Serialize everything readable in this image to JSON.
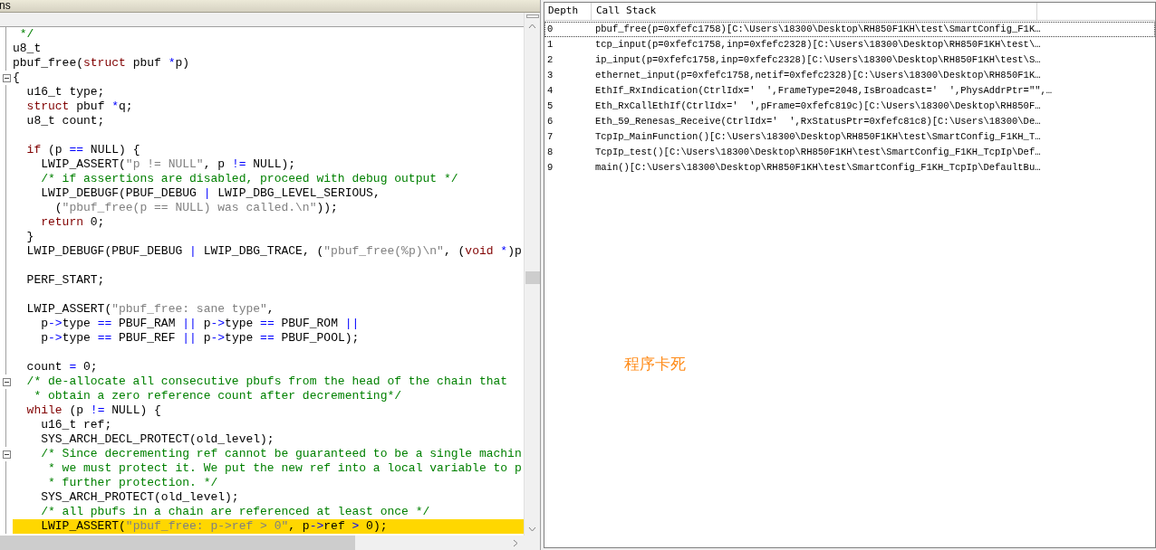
{
  "editor": {
    "title": "ns",
    "lines": [
      {
        "fold": false,
        "current": false,
        "tokens": [
          {
            "kind": "c",
            "text": " */"
          }
        ]
      },
      {
        "fold": false,
        "current": false,
        "tokens": [
          {
            "kind": "p",
            "text": "u8_t"
          }
        ]
      },
      {
        "fold": false,
        "current": false,
        "tokens": [
          {
            "kind": "p",
            "text": "pbuf_free("
          },
          {
            "kind": "k",
            "text": "struct"
          },
          {
            "kind": "p",
            "text": " pbuf "
          },
          {
            "kind": "o",
            "text": "*"
          },
          {
            "kind": "p",
            "text": "p)"
          }
        ]
      },
      {
        "fold": true,
        "current": false,
        "tokens": [
          {
            "kind": "p",
            "text": "{"
          }
        ]
      },
      {
        "fold": false,
        "current": false,
        "tokens": [
          {
            "kind": "p",
            "text": "  u16_t type;"
          }
        ]
      },
      {
        "fold": false,
        "current": false,
        "tokens": [
          {
            "kind": "k",
            "text": "  struct"
          },
          {
            "kind": "p",
            "text": " pbuf "
          },
          {
            "kind": "o",
            "text": "*"
          },
          {
            "kind": "p",
            "text": "q;"
          }
        ]
      },
      {
        "fold": false,
        "current": false,
        "tokens": [
          {
            "kind": "p",
            "text": "  u8_t count;"
          }
        ]
      },
      {
        "fold": false,
        "current": false
      },
      {
        "fold": false,
        "current": false,
        "tokens": [
          {
            "kind": "k",
            "text": "  if"
          },
          {
            "kind": "p",
            "text": " (p "
          },
          {
            "kind": "o",
            "text": "=="
          },
          {
            "kind": "p",
            "text": " NULL) {"
          }
        ]
      },
      {
        "fold": false,
        "current": false,
        "tokens": [
          {
            "kind": "p",
            "text": "    LWIP_ASSERT("
          },
          {
            "kind": "s",
            "text": "\"p != NULL\""
          },
          {
            "kind": "p",
            "text": ", p "
          },
          {
            "kind": "o",
            "text": "!="
          },
          {
            "kind": "p",
            "text": " NULL);"
          }
        ]
      },
      {
        "fold": false,
        "current": false,
        "tokens": [
          {
            "kind": "c",
            "text": "    /* if assertions are disabled, proceed with debug output */"
          }
        ]
      },
      {
        "fold": false,
        "current": false,
        "tokens": [
          {
            "kind": "p",
            "text": "    LWIP_DEBUGF(PBUF_DEBUG "
          },
          {
            "kind": "o",
            "text": "|"
          },
          {
            "kind": "p",
            "text": " LWIP_DBG_LEVEL_SERIOUS,"
          }
        ]
      },
      {
        "fold": false,
        "current": false,
        "tokens": [
          {
            "kind": "p",
            "text": "      ("
          },
          {
            "kind": "s",
            "text": "\"pbuf_free(p == NULL) was called.\\n\""
          },
          {
            "kind": "p",
            "text": "));"
          }
        ]
      },
      {
        "fold": false,
        "current": false,
        "tokens": [
          {
            "kind": "k",
            "text": "    return"
          },
          {
            "kind": "p",
            "text": " 0;"
          }
        ]
      },
      {
        "fold": false,
        "current": false,
        "tokens": [
          {
            "kind": "p",
            "text": "  }"
          }
        ]
      },
      {
        "fold": false,
        "current": false,
        "tokens": [
          {
            "kind": "p",
            "text": "  LWIP_DEBUGF(PBUF_DEBUG "
          },
          {
            "kind": "o",
            "text": "|"
          },
          {
            "kind": "p",
            "text": " LWIP_DBG_TRACE, ("
          },
          {
            "kind": "s",
            "text": "\"pbuf_free(%p)\\n\""
          },
          {
            "kind": "p",
            "text": ", ("
          },
          {
            "kind": "k",
            "text": "void"
          },
          {
            "kind": "o",
            "text": " *"
          },
          {
            "kind": "p",
            "text": ")p"
          }
        ]
      },
      {
        "fold": false,
        "current": false
      },
      {
        "fold": false,
        "current": false,
        "tokens": [
          {
            "kind": "p",
            "text": "  PERF_START;"
          }
        ]
      },
      {
        "fold": false,
        "current": false
      },
      {
        "fold": false,
        "current": false,
        "tokens": [
          {
            "kind": "p",
            "text": "  LWIP_ASSERT("
          },
          {
            "kind": "s",
            "text": "\"pbuf_free: sane type\""
          },
          {
            "kind": "p",
            "text": ","
          }
        ]
      },
      {
        "fold": false,
        "current": false,
        "tokens": [
          {
            "kind": "p",
            "text": "    p"
          },
          {
            "kind": "o",
            "text": "->"
          },
          {
            "kind": "p",
            "text": "type "
          },
          {
            "kind": "o",
            "text": "=="
          },
          {
            "kind": "p",
            "text": " PBUF_RAM "
          },
          {
            "kind": "o",
            "text": "||"
          },
          {
            "kind": "p",
            "text": " p"
          },
          {
            "kind": "o",
            "text": "->"
          },
          {
            "kind": "p",
            "text": "type "
          },
          {
            "kind": "o",
            "text": "=="
          },
          {
            "kind": "p",
            "text": " PBUF_ROM "
          },
          {
            "kind": "o",
            "text": "||"
          }
        ]
      },
      {
        "fold": false,
        "current": false,
        "tokens": [
          {
            "kind": "p",
            "text": "    p"
          },
          {
            "kind": "o",
            "text": "->"
          },
          {
            "kind": "p",
            "text": "type "
          },
          {
            "kind": "o",
            "text": "=="
          },
          {
            "kind": "p",
            "text": " PBUF_REF "
          },
          {
            "kind": "o",
            "text": "||"
          },
          {
            "kind": "p",
            "text": " p"
          },
          {
            "kind": "o",
            "text": "->"
          },
          {
            "kind": "p",
            "text": "type "
          },
          {
            "kind": "o",
            "text": "=="
          },
          {
            "kind": "p",
            "text": " PBUF_POOL);"
          }
        ]
      },
      {
        "fold": false,
        "current": false
      },
      {
        "fold": false,
        "current": false,
        "tokens": [
          {
            "kind": "p",
            "text": "  count "
          },
          {
            "kind": "o",
            "text": "="
          },
          {
            "kind": "p",
            "text": " 0;"
          }
        ]
      },
      {
        "fold": true,
        "current": false,
        "tokens": [
          {
            "kind": "c",
            "text": "  /* de-allocate all consecutive pbufs from the head of the chain that"
          }
        ]
      },
      {
        "fold": false,
        "current": false,
        "tokens": [
          {
            "kind": "c",
            "text": "   * obtain a zero reference count after decrementing*/"
          }
        ]
      },
      {
        "fold": false,
        "current": false,
        "tokens": [
          {
            "kind": "k",
            "text": "  while"
          },
          {
            "kind": "p",
            "text": " (p "
          },
          {
            "kind": "o",
            "text": "!="
          },
          {
            "kind": "p",
            "text": " NULL) {"
          }
        ]
      },
      {
        "fold": false,
        "current": false,
        "tokens": [
          {
            "kind": "p",
            "text": "    u16_t ref;"
          }
        ]
      },
      {
        "fold": false,
        "current": false,
        "tokens": [
          {
            "kind": "p",
            "text": "    SYS_ARCH_DECL_PROTECT(old_level);"
          }
        ]
      },
      {
        "fold": true,
        "current": false,
        "tokens": [
          {
            "kind": "c",
            "text": "    /* Since decrementing ref cannot be guaranteed to be a single machin"
          }
        ]
      },
      {
        "fold": false,
        "current": false,
        "tokens": [
          {
            "kind": "c",
            "text": "     * we must protect it. We put the new ref into a local variable to p"
          }
        ]
      },
      {
        "fold": false,
        "current": false,
        "tokens": [
          {
            "kind": "c",
            "text": "     * further protection. */"
          }
        ]
      },
      {
        "fold": false,
        "current": false,
        "tokens": [
          {
            "kind": "p",
            "text": "    SYS_ARCH_PROTECT(old_level);"
          }
        ]
      },
      {
        "fold": false,
        "current": false,
        "tokens": [
          {
            "kind": "c",
            "text": "    /* all pbufs in a chain are referenced at least once */"
          }
        ]
      },
      {
        "fold": false,
        "current": true,
        "tokens": [
          {
            "kind": "p",
            "text": "    LWIP_ASSERT("
          },
          {
            "kind": "s",
            "text": "\"pbuf_free: p->ref > 0\""
          },
          {
            "kind": "p",
            "text": ", p"
          },
          {
            "kind": "o",
            "text": "->"
          },
          {
            "kind": "p",
            "text": "ref "
          },
          {
            "kind": "o",
            "text": ">"
          },
          {
            "kind": "p",
            "text": " 0);"
          }
        ]
      }
    ]
  },
  "call_stack": {
    "columns": [
      "Depth",
      "Call Stack"
    ],
    "rows": [
      {
        "depth": "0",
        "selected": true,
        "call": "pbuf_free(p=0xfefc1758)[C:\\Users\\18300\\Desktop\\RH850F1KH\\test\\SmartConfig_F1K…"
      },
      {
        "depth": "1",
        "selected": false,
        "call": "tcp_input(p=0xfefc1758,inp=0xfefc2328)[C:\\Users\\18300\\Desktop\\RH850F1KH\\test\\…"
      },
      {
        "depth": "2",
        "selected": false,
        "call": "ip_input(p=0xfefc1758,inp=0xfefc2328)[C:\\Users\\18300\\Desktop\\RH850F1KH\\test\\S…"
      },
      {
        "depth": "3",
        "selected": false,
        "call": "ethernet_input(p=0xfefc1758,netif=0xfefc2328)[C:\\Users\\18300\\Desktop\\RH850F1K…"
      },
      {
        "depth": "4",
        "selected": false,
        "call": "EthIf_RxIndication(CtrlIdx='  ',FrameType=2048,IsBroadcast='  ',PhysAddrPtr=\"\",…"
      },
      {
        "depth": "5",
        "selected": false,
        "call": "Eth_RxCallEthIf(CtrlIdx='  ',pFrame=0xfefc819c)[C:\\Users\\18300\\Desktop\\RH850F…"
      },
      {
        "depth": "6",
        "selected": false,
        "call": "Eth_59_Renesas_Receive(CtrlIdx='  ',RxStatusPtr=0xfefc81c8)[C:\\Users\\18300\\De…"
      },
      {
        "depth": "7",
        "selected": false,
        "call": "TcpIp_MainFunction()[C:\\Users\\18300\\Desktop\\RH850F1KH\\test\\SmartConfig_F1KH_T…"
      },
      {
        "depth": "8",
        "selected": false,
        "call": "TcpIp_test()[C:\\Users\\18300\\Desktop\\RH850F1KH\\test\\SmartConfig_F1KH_TcpIp\\Def…"
      },
      {
        "depth": "9",
        "selected": false,
        "call": "main()[C:\\Users\\18300\\Desktop\\RH850F1KH\\test\\SmartConfig_F1KH_TcpIp\\DefaultBu…"
      }
    ],
    "annotation": "程序卡死"
  }
}
